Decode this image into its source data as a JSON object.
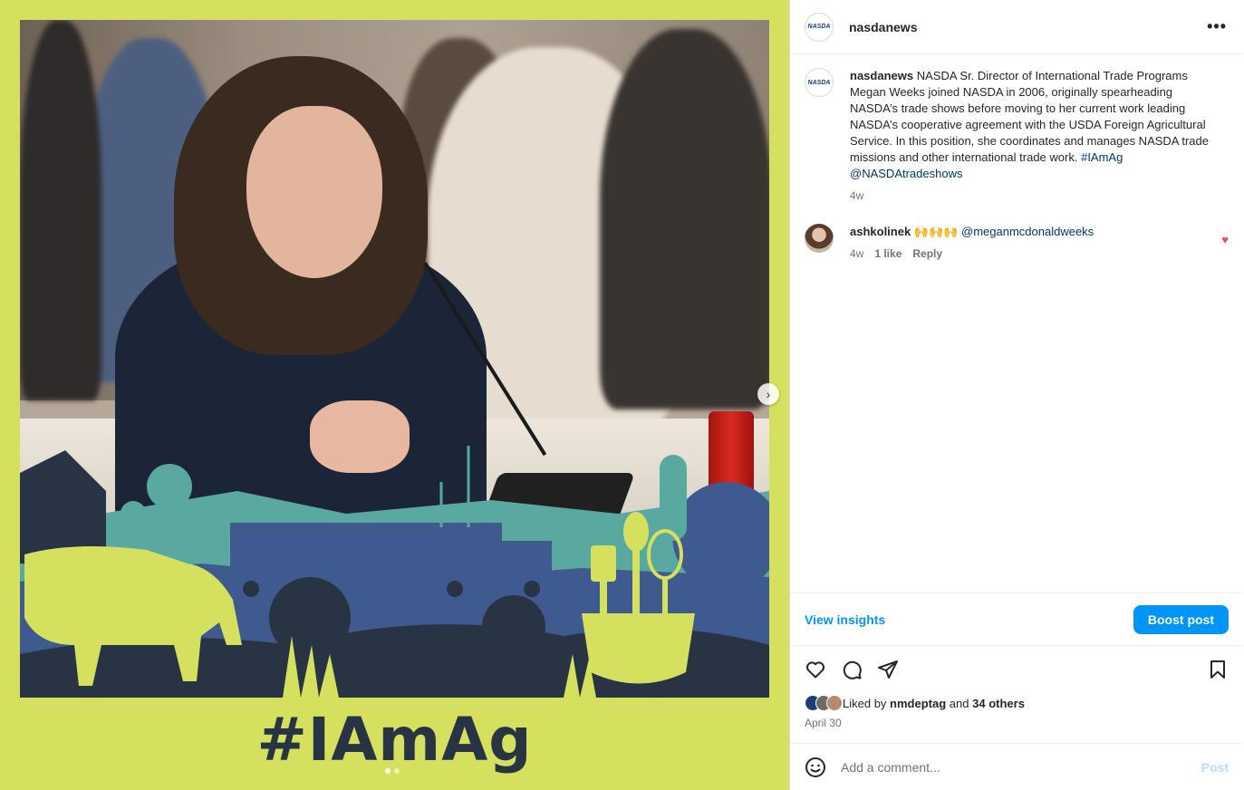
{
  "media": {
    "hashtag_text": "#IAmAg",
    "carousel_next_icon": "chevron-right-icon",
    "carousel_dots": 2,
    "carousel_active_index": 0
  },
  "header": {
    "username": "nasdanews",
    "logo_text": "NASDA",
    "more_icon": "more-horizontal-icon",
    "more_label": "•••"
  },
  "caption": {
    "username": "nasdanews",
    "text": "NASDA Sr. Director of International Trade Programs Megan Weeks joined NASDA in 2006, originally spearheading NASDA’s trade shows before moving to her current work leading NASDA’s cooperative agreement with the USDA Foreign Agricultural Service. In this position, she coordinates and manages NASDA trade missions and other international trade work.",
    "hashtag": "#IAmAg",
    "mention": "@NASDAtradeshows",
    "time": "4w"
  },
  "comment": {
    "username": "ashkolinek",
    "emojis": "🙌🙌🙌",
    "mention": "@meganmcdonaldweeks",
    "time": "4w",
    "likes": "1 like",
    "reply_label": "Reply",
    "liked": true
  },
  "insights": {
    "view_label": "View insights",
    "boost_label": "Boost post"
  },
  "actions": {
    "icons": [
      "heart-icon",
      "comment-icon",
      "share-icon",
      "bookmark-icon"
    ],
    "liked_by_prefix": "Liked by",
    "liked_by_user": "nmdeptag",
    "liked_by_and": "and",
    "liked_by_others": "34 others",
    "date": "April 30"
  },
  "add_comment": {
    "placeholder": "Add a comment...",
    "post_label": "Post",
    "emoji_icon": "smiley-icon"
  },
  "colors": {
    "frame_yellow": "#d6e05f",
    "hashtag_navy": "#283444",
    "accent_blue": "#0095f6",
    "link_blue": "#00376b",
    "heart_red": "#ed4956"
  }
}
